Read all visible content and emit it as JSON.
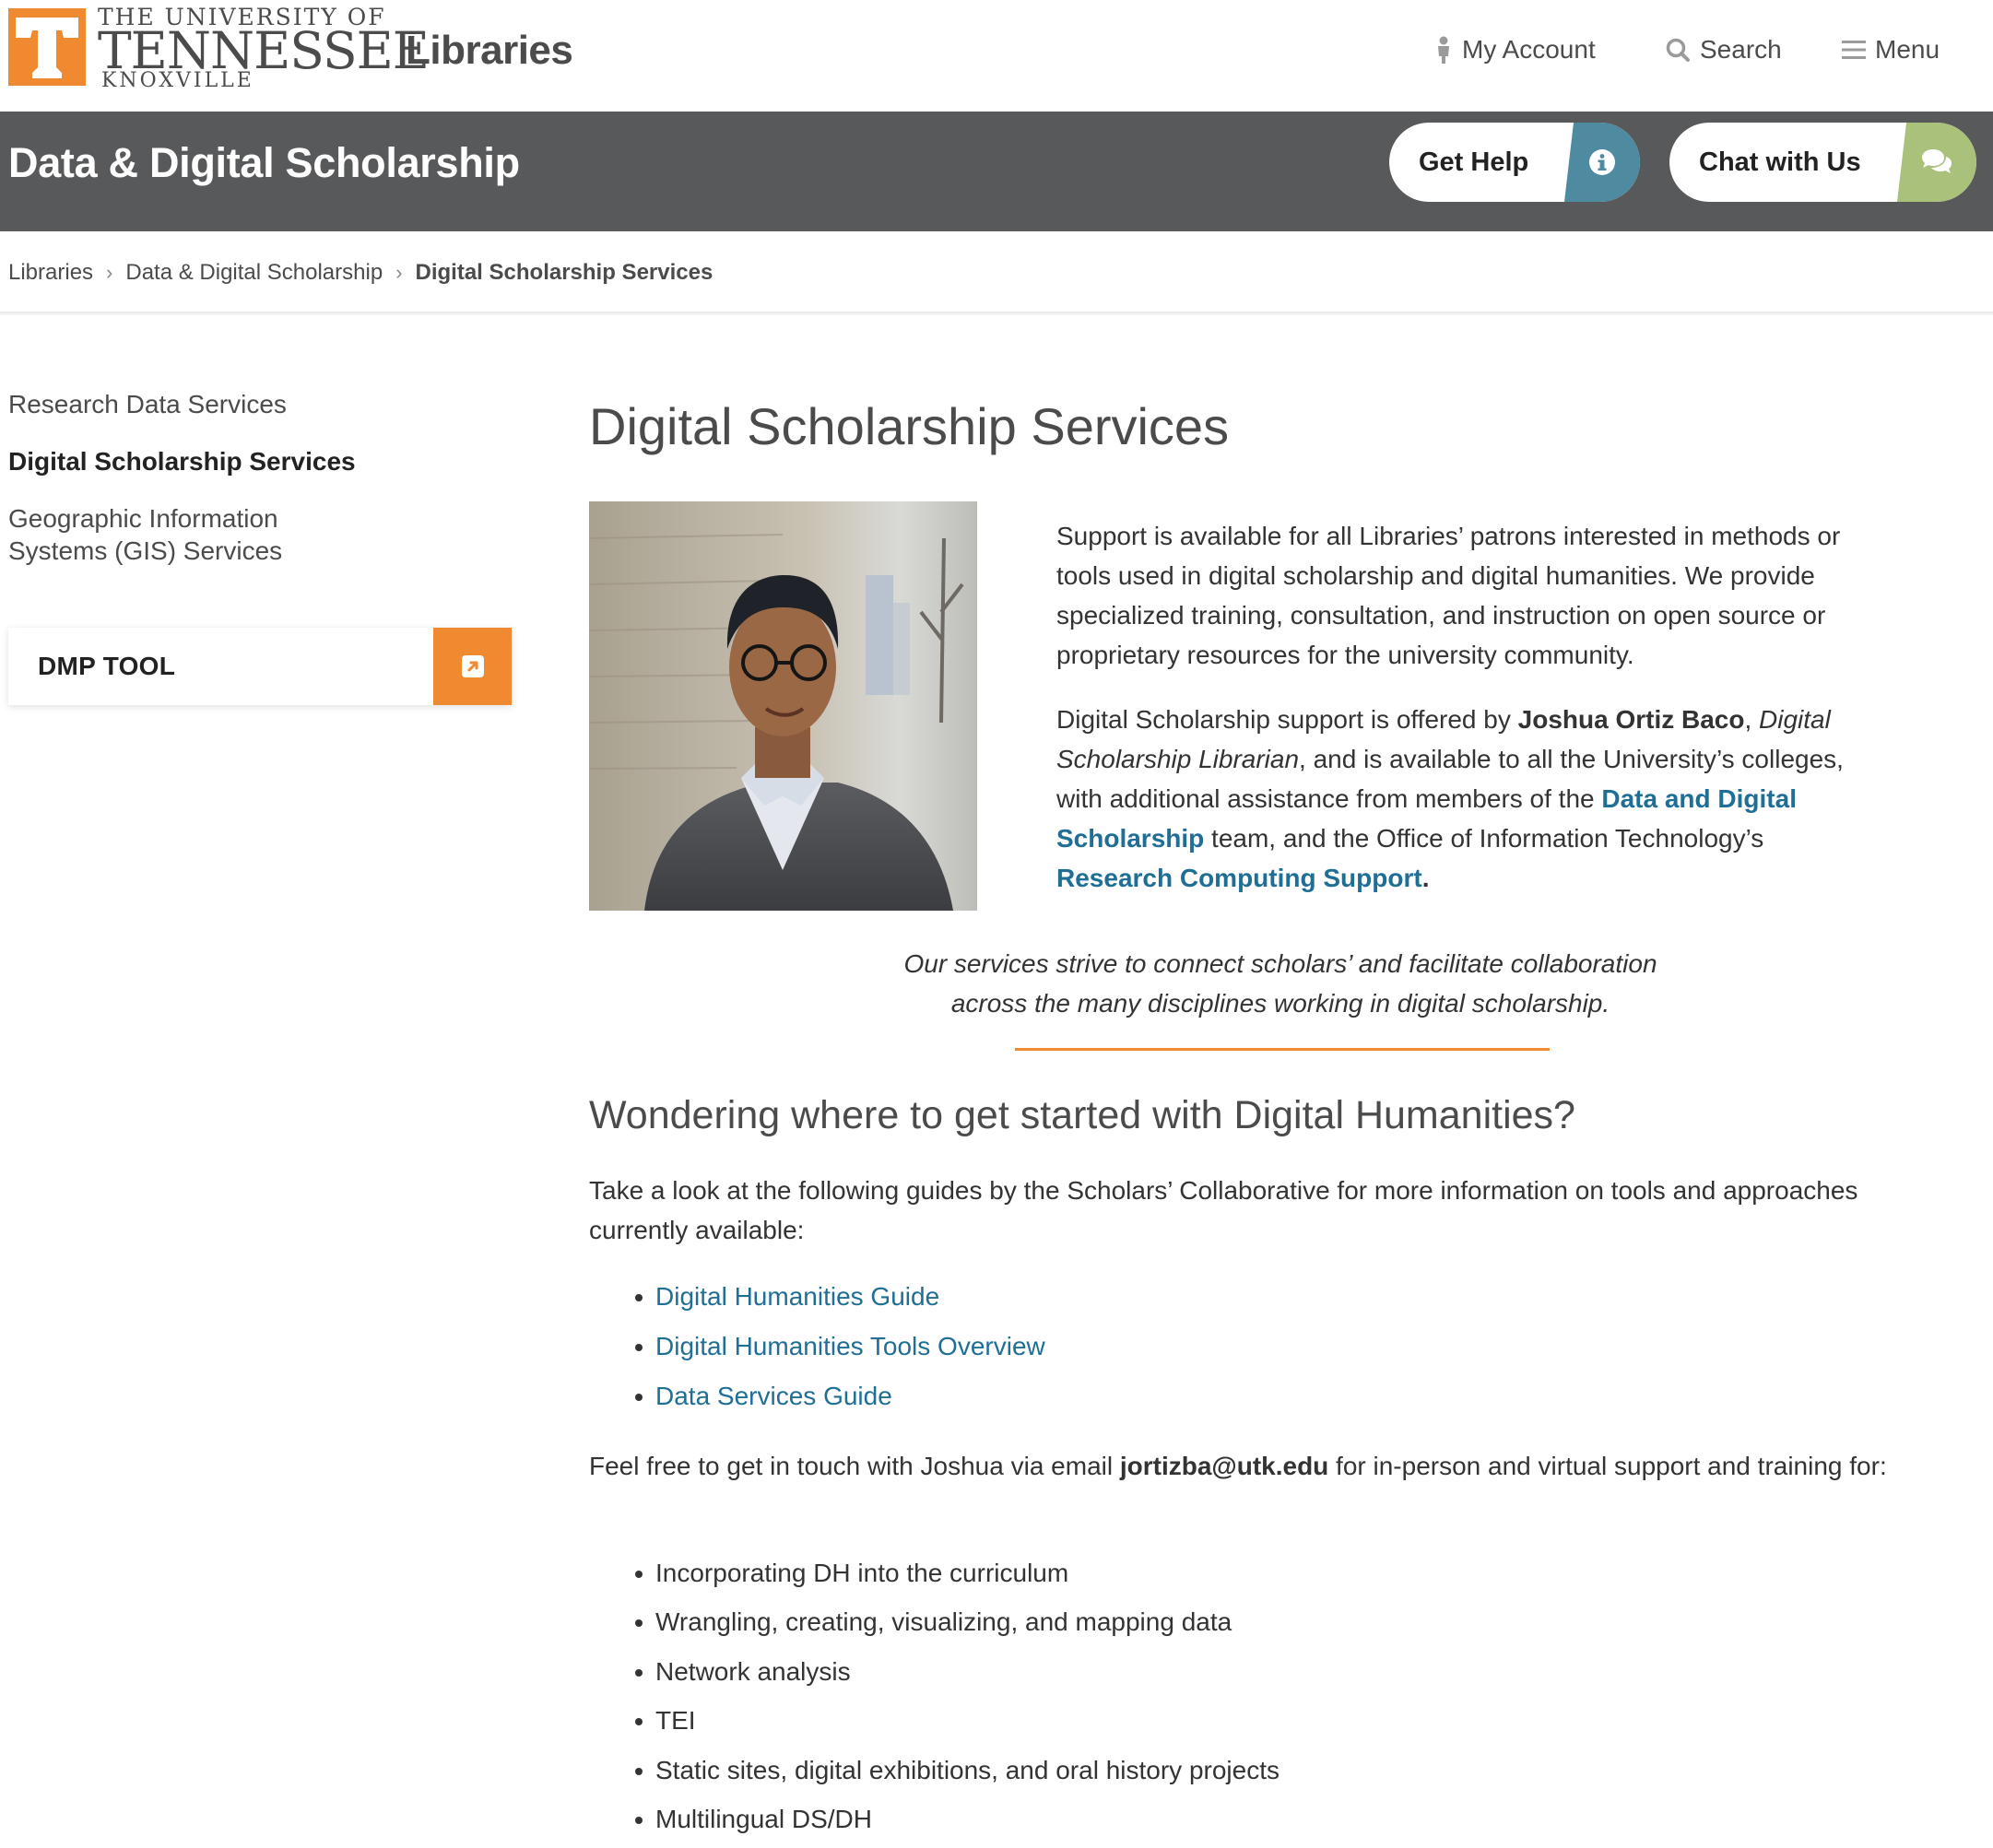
{
  "header": {
    "university_line1": "THE UNIVERSITY OF",
    "university_line2": "TENNESSEE",
    "university_line3": "KNOXVILLE",
    "site_name": "Libraries",
    "utility_links": [
      {
        "label": "My Account",
        "icon": "person-icon"
      },
      {
        "label": "Search",
        "icon": "search-icon"
      },
      {
        "label": "Menu",
        "icon": "hamburger-icon"
      }
    ]
  },
  "band": {
    "title": "Data & Digital Scholarship",
    "help_label": "Get Help",
    "help_icon": "info-icon",
    "chat_label": "Chat with Us",
    "chat_icon": "chat-bubbles-icon"
  },
  "breadcrumb": [
    "Libraries",
    "Data & Digital Scholarship",
    "Digital Scholarship Services"
  ],
  "sidebar": {
    "items": [
      {
        "label": "Research Data Services",
        "active": false
      },
      {
        "label": "Digital Scholarship Services",
        "active": true
      },
      {
        "label": "Geographic Information Systems (GIS) Services",
        "active": false
      }
    ],
    "dmp_label": "DMP TOOL",
    "dmp_icon": "external-link-icon"
  },
  "main": {
    "title": "Digital Scholarship Services",
    "intro_p1": "Support is available for all Libraries’ patrons interested in methods or tools used in digital scholarship and digital humanities. We provide specialized training, consultation, and instruction on open source or proprietary resources for the university community.",
    "intro_p2": {
      "t1": "Digital Scholarship support is offered by ",
      "name": "Joshua Ortiz Baco",
      "t2": ", ",
      "role": "Digital Scholarship Librarian",
      "t3": ", and is available to all the University’s colleges, with additional assistance from members of the ",
      "link1": "Data and Digital Scholarship",
      "t4": " team, and the Office of Information Technology’s ",
      "link2": "Research Computing Support",
      "t5": "."
    },
    "quote_line1": "Our services strive to connect scholars’ and facilitate collaboration",
    "quote_line2": "across the many disciplines working in digital scholarship.",
    "subheading": "Wondering where to get started with Digital Humanities?",
    "guides_intro": "Take a look at the following guides by the Scholars’ Collaborative for more information on tools and approaches currently available:",
    "guides": [
      "Digital Humanities Guide",
      "Digital Humanities Tools Overview",
      "Data Services Guide"
    ],
    "contact": {
      "t1": "Feel free to get in touch with Joshua via email ",
      "email": "jortizba@utk.edu",
      "t2": " for in-person and virtual support and training for:"
    },
    "topics": [
      "Incorporating DH into the curriculum",
      "Wrangling, creating, visualizing, and mapping data",
      "Network analysis",
      "TEI",
      "Static sites, digital exhibitions, and oral history projects",
      "Multilingual DS/DH"
    ]
  },
  "colors": {
    "brand_orange": "#f08a30",
    "band_gray": "#58595b",
    "link_blue": "#1f6e96",
    "help_blue": "#4f8ba0",
    "chat_green": "#a9c17a"
  }
}
